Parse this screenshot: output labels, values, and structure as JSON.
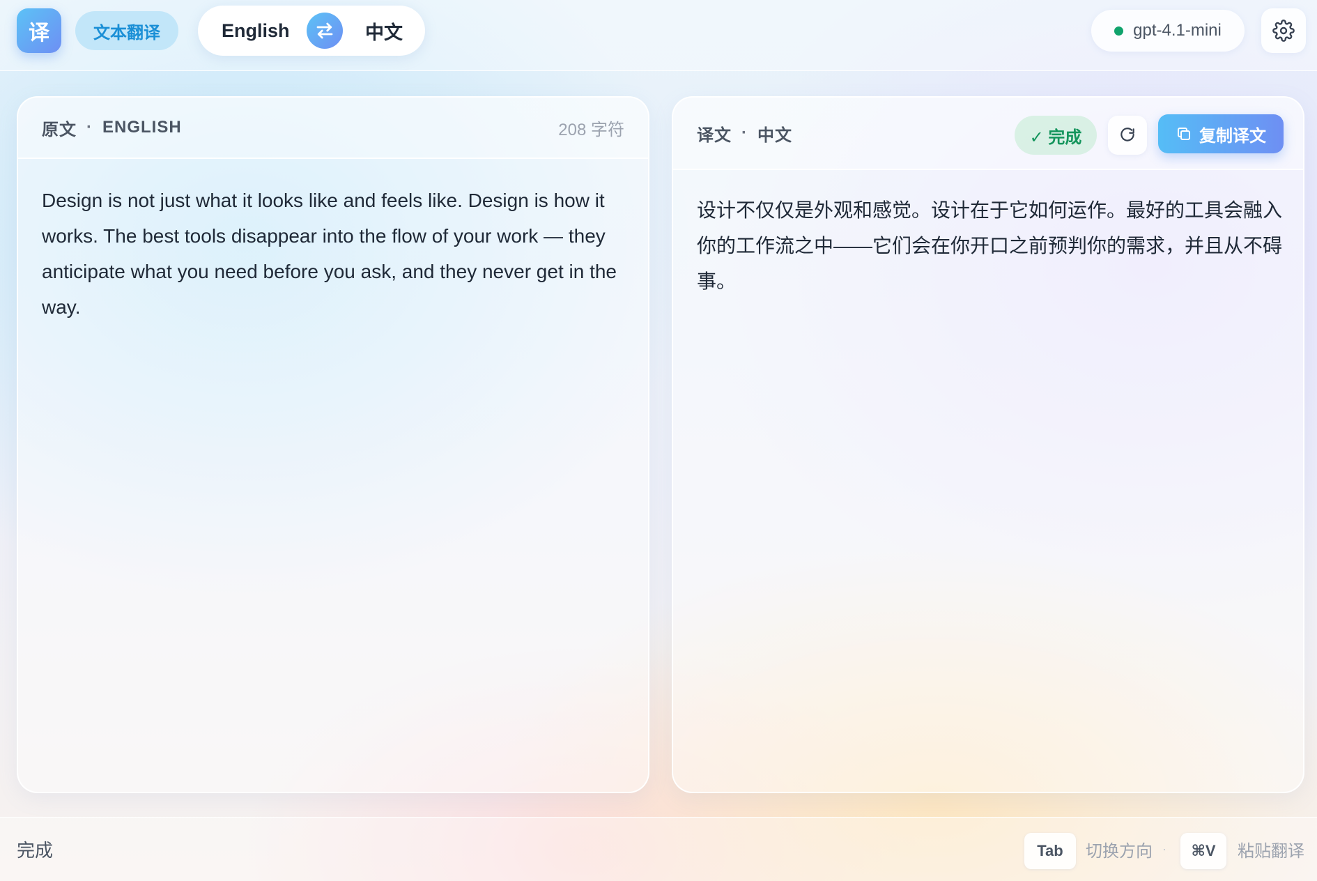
{
  "header": {
    "logo_char": "译",
    "mode_label": "文本翻译",
    "source_lang": "English",
    "target_lang": "中文",
    "swap_icon": "swap-arrows-icon",
    "model": "gpt-4.1-mini",
    "model_status_color": "#10a36c",
    "settings_icon": "gear-icon"
  },
  "source_panel": {
    "title": "原文",
    "separator": "·",
    "lang": "ENGLISH",
    "char_count": "208 字符",
    "text": "Design is not just what it looks like and feels like. Design is how it works. The best tools disappear into the flow of your work — they anticipate what you need before you ask, and they never get in the way."
  },
  "target_panel": {
    "title": "译文",
    "separator": "·",
    "lang": "中文",
    "status": "✓ 完成",
    "refresh_icon": "refresh-icon",
    "copy_icon": "copy-icon",
    "copy_label": "复制译文",
    "text": "设计不仅仅是外观和感觉。设计在于它如何运作。最好的工具会融入你的工作流之中——它们会在你开口之前预判你的需求，并且从不碍事。"
  },
  "footer": {
    "status": "完成",
    "shortcut_switch_key": "Tab",
    "shortcut_switch_label": "切换方向",
    "separator": "·",
    "shortcut_paste_key": "⌘V",
    "shortcut_paste_label": "粘贴翻译"
  },
  "colors": {
    "accent_start": "#5cc2f6",
    "accent_end": "#6e8ff3",
    "success": "#14955c"
  }
}
